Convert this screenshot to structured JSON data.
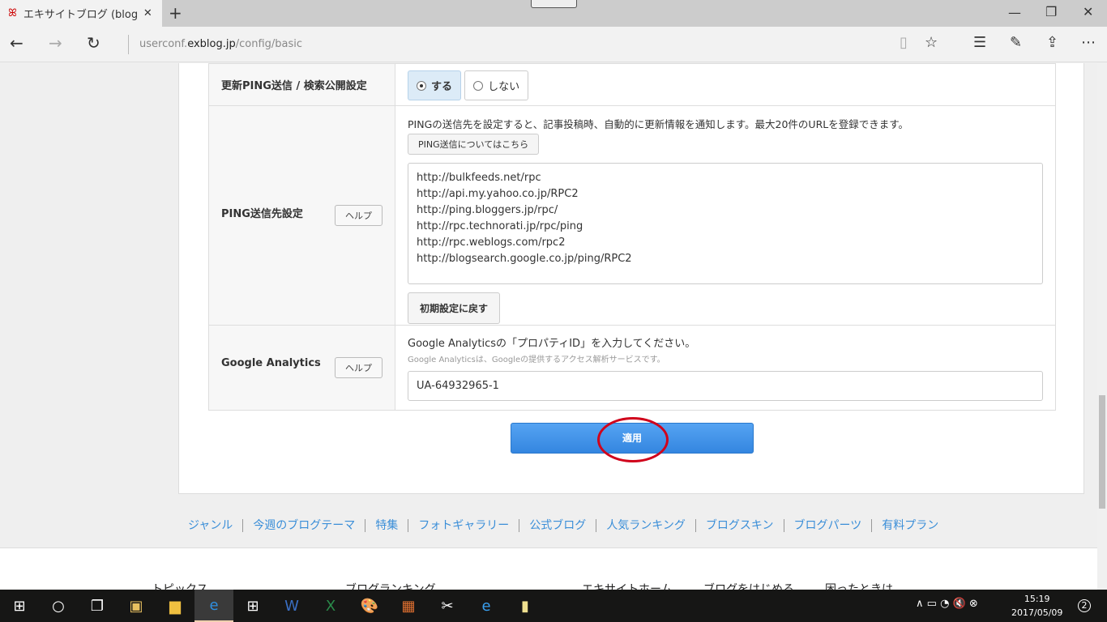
{
  "browser": {
    "tab_title": "エキサイトブログ (blog)|基本",
    "url_prefix": "userconf.",
    "url_domain": "exblog.jp",
    "url_path": "/config/basic"
  },
  "settings": {
    "ping_label": "更新PING送信 / 検索公開設定",
    "ping_on": "する",
    "ping_off": "しない",
    "ping_selected": "する",
    "ping_dest_label": "PING送信先設定",
    "help": "ヘルプ",
    "ping_desc": "PINGの送信先を設定すると、記事投稿時、自動的に更新情報を通知します。最大20件のURLを登録できます。",
    "ping_about": "PING送信についてはこちら",
    "ping_urls": [
      "http://bulkfeeds.net/rpc",
      "http://api.my.yahoo.co.jp/RPC2",
      "http://ping.bloggers.jp/rpc/",
      "http://rpc.technorati.jp/rpc/ping",
      "http://rpc.weblogs.com/rpc2",
      "http://blogsearch.google.co.jp/ping/RPC2"
    ],
    "reset": "初期設定に戻す",
    "ga_label": "Google Analytics",
    "ga_desc": "Google Analyticsの「プロパティID」を入力してください。",
    "ga_sub": "Google Analyticsは、Googleの提供するアクセス解析サービスです。",
    "ga_value": "UA-64932965-1",
    "apply": "適用"
  },
  "footer_links": [
    "ジャンル",
    "今週のブログテーマ",
    "特集",
    "フォトギャラリー",
    "公式ブログ",
    "人気ランキング",
    "ブログスキン",
    "ブログパーツ",
    "有料プラン"
  ],
  "footer": {
    "topics": "トピックス",
    "ranking": "ブログランキング",
    "home": "エキサイトホーム",
    "start": "ブログをはじめる",
    "trouble": "困ったときは"
  },
  "taskbar": {
    "time": "15:19",
    "date": "2017/05/09",
    "notifications": "2"
  },
  "colors": {
    "accent": "#3d8fe8",
    "annotation": "#d0021b",
    "link": "#3a8ed8"
  }
}
